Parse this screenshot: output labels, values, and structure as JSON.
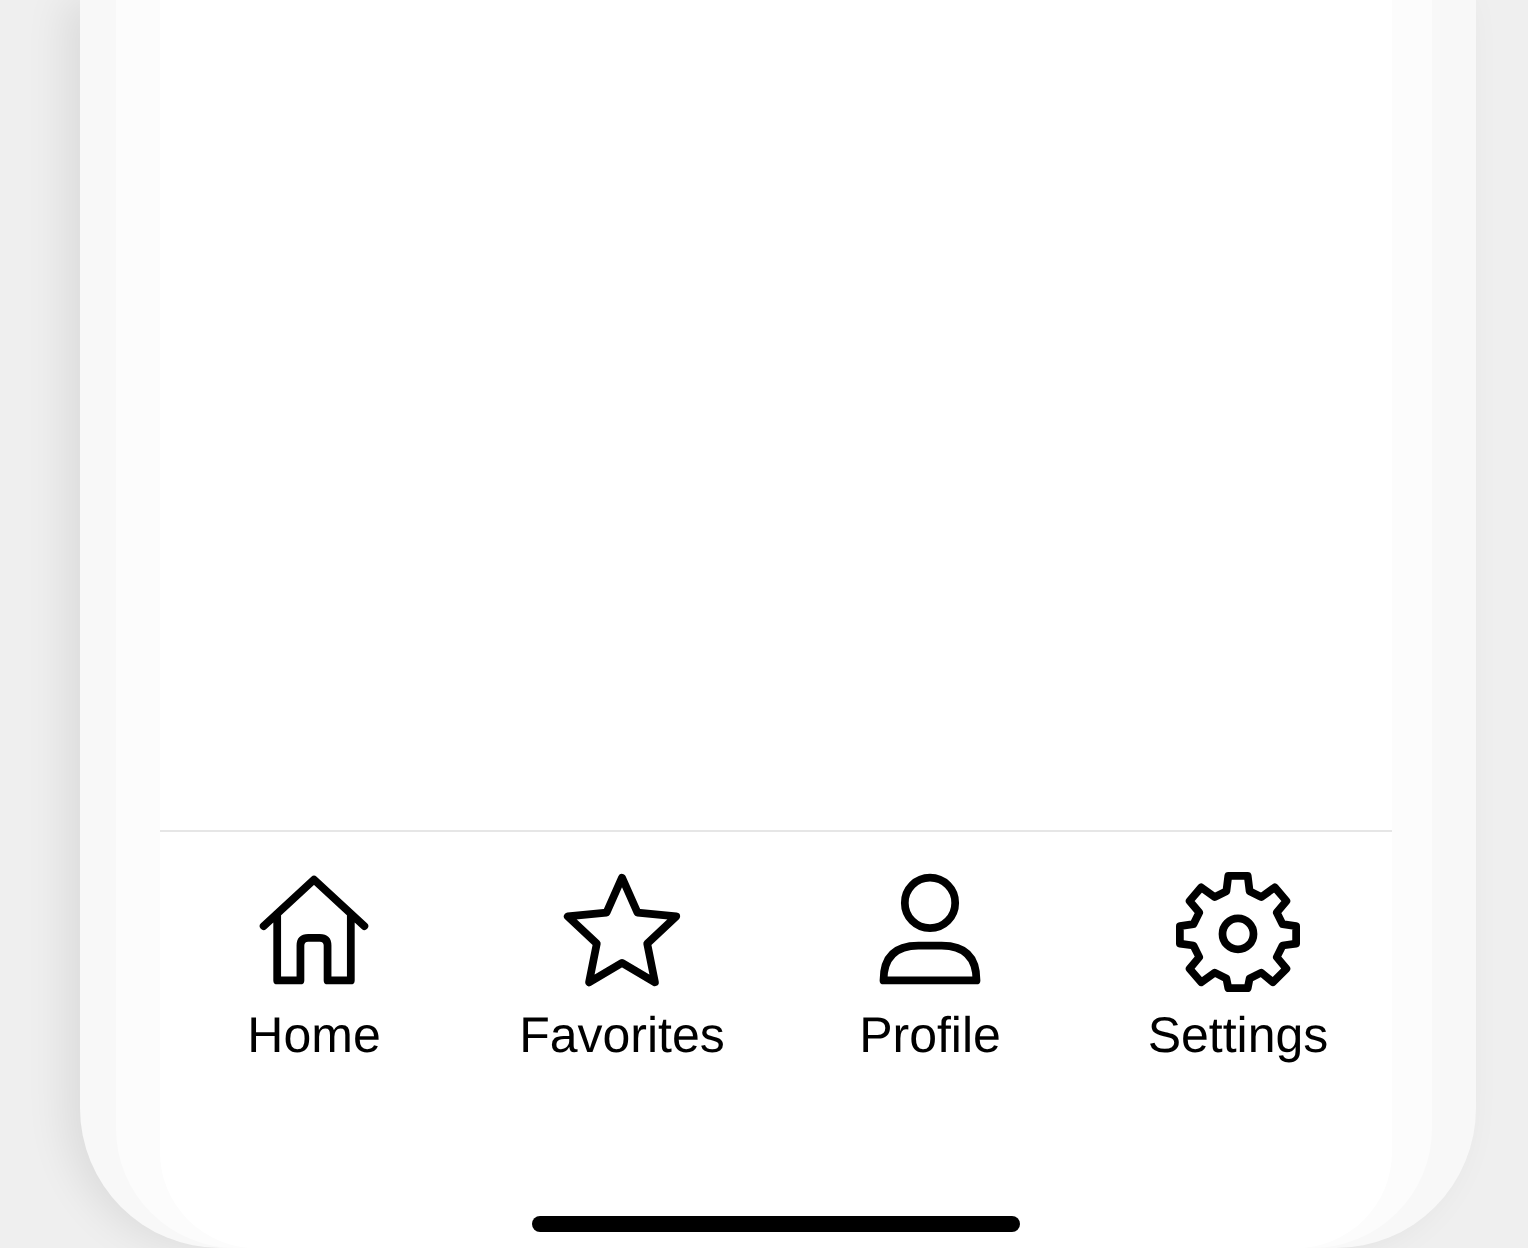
{
  "tab_bar": {
    "items": [
      {
        "kind": "home",
        "label": "Home"
      },
      {
        "kind": "star",
        "label": "Favorites"
      },
      {
        "kind": "person",
        "label": "Profile"
      },
      {
        "kind": "gear",
        "label": "Settings"
      }
    ]
  }
}
